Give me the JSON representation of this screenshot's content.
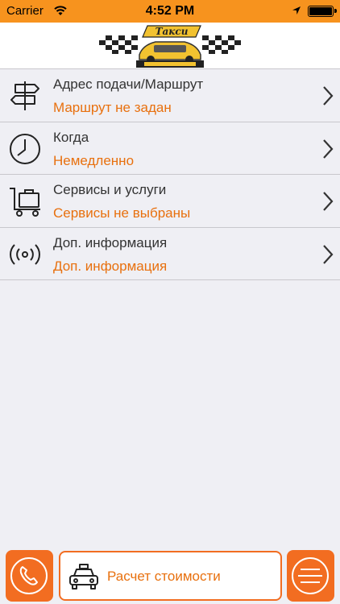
{
  "status_bar": {
    "carrier": "Carrier",
    "time": "4:52 PM"
  },
  "header": {
    "logo_alt": "Такси"
  },
  "rows": [
    {
      "title": "Адрес подачи/Маршрут",
      "value": "Маршрут не задан",
      "icon": "signpost-icon"
    },
    {
      "title": "Когда",
      "value": "Немедленно",
      "icon": "clock-icon"
    },
    {
      "title": "Сервисы и услуги",
      "value": "Сервисы не выбраны",
      "icon": "luggage-cart-icon"
    },
    {
      "title": "Доп. информация",
      "value": "Доп. информация",
      "icon": "broadcast-icon"
    }
  ],
  "bottom_bar": {
    "calc_label": "Расчет стоимости"
  },
  "colors": {
    "accent": "#f26d21",
    "status_bar": "#f7931e",
    "value_text": "#e8700e",
    "background": "#efeff4"
  }
}
